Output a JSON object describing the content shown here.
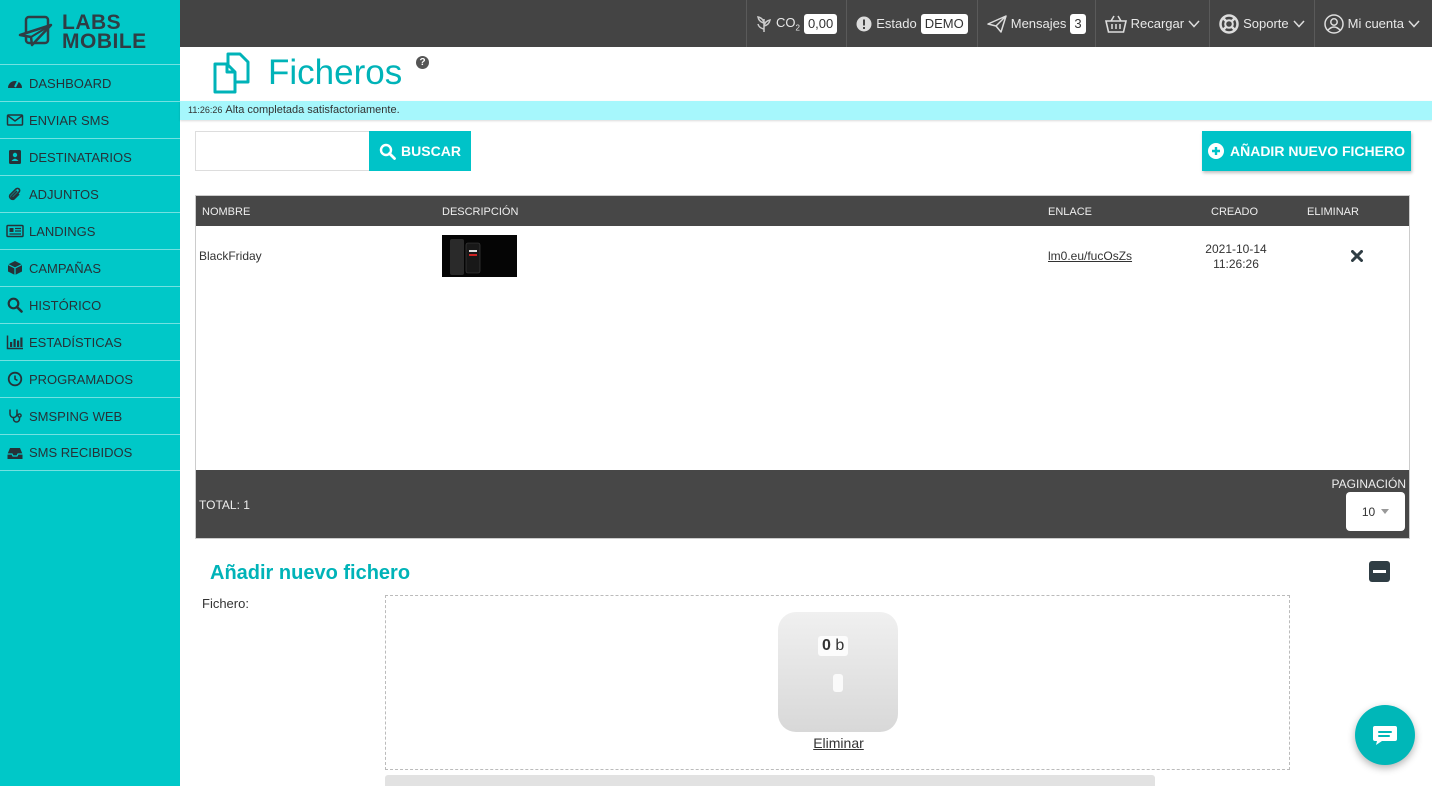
{
  "logo": {
    "line1": "LABS",
    "line2": "MOBILE"
  },
  "sidebar": {
    "items": [
      {
        "label": "DASHBOARD"
      },
      {
        "label": "ENVIAR SMS"
      },
      {
        "label": "DESTINATARIOS"
      },
      {
        "label": "ADJUNTOS"
      },
      {
        "label": "LANDINGS"
      },
      {
        "label": "CAMPAÑAS"
      },
      {
        "label": "HISTÓRICO"
      },
      {
        "label": "ESTADÍSTICAS"
      },
      {
        "label": "PROGRAMADOS"
      },
      {
        "label": "SMSPING WEB"
      },
      {
        "label": "SMS RECIBIDOS"
      }
    ]
  },
  "topbar": {
    "co2_label": "CO",
    "co2_sub": "2",
    "co2_value": "0,00",
    "estado_label": "Estado",
    "estado_value": "DEMO",
    "mensajes_label": "Mensajes",
    "mensajes_count": "3",
    "recargar_label": "Recargar",
    "soporte_label": "Soporte",
    "cuenta_label": "Mi cuenta"
  },
  "page": {
    "title": "Ficheros",
    "help": "?"
  },
  "alert": {
    "time": "11:26:26",
    "message": "Alta completada satisfactoriamente."
  },
  "search": {
    "value": "",
    "button_label": "BUSCAR"
  },
  "add_button_label": "AÑADIR NUEVO FICHERO",
  "table": {
    "columns": [
      "NOMBRE",
      "DESCRIPCIÓN",
      "ENLACE",
      "CREADO",
      "ELIMINAR"
    ],
    "rows": [
      {
        "nombre": "BlackFriday",
        "enlace": "lm0.eu/fucOsZs",
        "creado_fecha": "2021-10-14",
        "creado_hora": "11:26:26"
      }
    ],
    "total": "TOTAL: 1",
    "pagination_label": "PAGINACIÓN",
    "pagination_value": "10"
  },
  "form": {
    "title": "Añadir nuevo fichero",
    "file_label": "Fichero:",
    "file_size_number": "0",
    "file_size_unit": "b",
    "remove_label": "Eliminar"
  },
  "colors": {
    "accent": "#00c8c8",
    "dark": "#444444",
    "alert": "#a6f7fc"
  }
}
